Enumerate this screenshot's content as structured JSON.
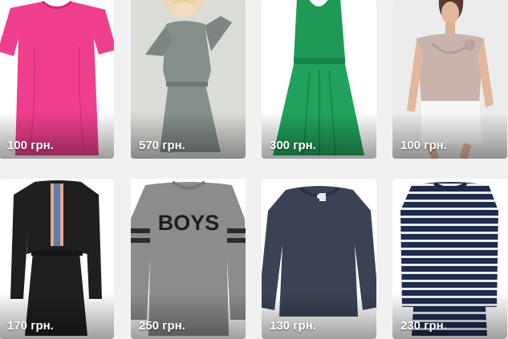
{
  "products": [
    {
      "price": "100 грн.",
      "image": "pink-tshirt"
    },
    {
      "price": "570 грн.",
      "image": "grey-long-sleeve-dress"
    },
    {
      "price": "300 грн.",
      "image": "green-sleeveless-dress"
    },
    {
      "price": "100 грн.",
      "image": "beige-draped-top"
    },
    {
      "price": "170 грн.",
      "image": "black-henley-dress"
    },
    {
      "price": "250 грн.",
      "image": "grey-boys-sweatshirt"
    },
    {
      "price": "130 грн.",
      "image": "navy-long-sleeve-top"
    },
    {
      "price": "230 грн.",
      "image": "navy-striped-sweater-dress"
    }
  ],
  "sweatshirt_print": "BOYS",
  "colors": {
    "background": "#f1f1f1",
    "card": "#ffffff",
    "price_text": "#ffffff"
  }
}
